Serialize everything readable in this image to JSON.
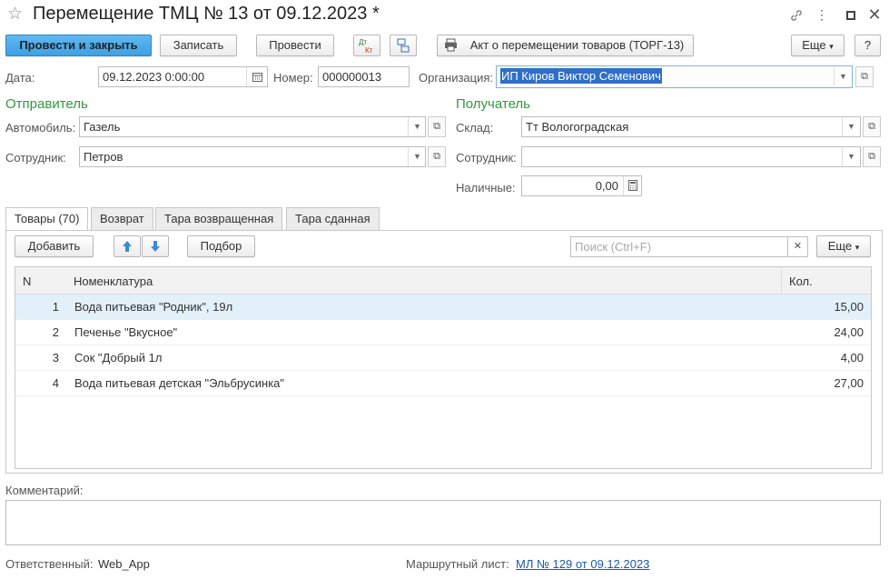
{
  "window": {
    "title": "Перемещение ТМЦ № 13 от 09.12.2023 *"
  },
  "toolbar": {
    "post_close": "Провести и закрыть",
    "save": "Записать",
    "post": "Провести",
    "dtkt_top": "Дт",
    "dtkt_bottom": "Кт",
    "print_label": "Акт о перемещении товаров (ТОРГ-13)",
    "more": "Еще",
    "help": "?"
  },
  "header": {
    "date_label": "Дата:",
    "date_value": "09.12.2023  0:00:00",
    "number_label": "Номер:",
    "number_value": "000000013",
    "org_label": "Организация:",
    "org_value": "ИП Киров Виктор Семенович"
  },
  "sender": {
    "title": "Отправитель",
    "car_label": "Автомобиль:",
    "car_value": "Газель",
    "employee_label": "Сотрудник:",
    "employee_value": "Петров"
  },
  "receiver": {
    "title": "Получатель",
    "warehouse_label": "Склад:",
    "warehouse_value": "Тт Вологоградская",
    "employee_label": "Сотрудник:",
    "employee_value": "",
    "cash_label": "Наличные:",
    "cash_value": "0,00"
  },
  "tabs": [
    {
      "label": "Товары (70)"
    },
    {
      "label": "Возврат"
    },
    {
      "label": "Тара возвращенная"
    },
    {
      "label": "Тара сданная"
    }
  ],
  "table_toolbar": {
    "add": "Добавить",
    "pick": "Подбор",
    "search_placeholder": "Поиск (Ctrl+F)",
    "more": "Еще"
  },
  "table": {
    "columns": {
      "n": "N",
      "item": "Номенклатура",
      "qty": "Кол."
    },
    "rows": [
      {
        "n": "1",
        "item": "Вода питьевая \"Родник\", 19л",
        "qty": "15,00"
      },
      {
        "n": "2",
        "item": "Печенье \"Вкусное\"",
        "qty": "24,00"
      },
      {
        "n": "3",
        "item": "Сок \"Добрый  1л",
        "qty": "4,00"
      },
      {
        "n": "4",
        "item": "Вода питьевая детская \"Эльбрусинка\"",
        "qty": "27,00"
      }
    ]
  },
  "footer": {
    "comment_label": "Комментарий:",
    "responsible_label": "Ответственный:",
    "responsible_value": "Web_App",
    "route_label": "Маршрутный лист:",
    "route_value": "МЛ № 129 от 09.12.2023"
  },
  "colors": {
    "primary_button": "#3ea0e4",
    "section_title": "#2f9a3a",
    "link": "#1a5aa8",
    "selection": "#2f6fc7",
    "selected_row": "#e2f0fa"
  }
}
